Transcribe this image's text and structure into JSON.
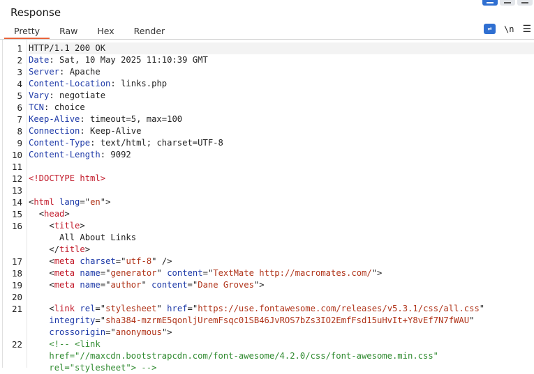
{
  "panel": {
    "title": "Response"
  },
  "tabs": [
    {
      "label": "Pretty"
    },
    {
      "label": "Raw"
    },
    {
      "label": "Hex"
    },
    {
      "label": "Render"
    }
  ],
  "toolbar": {
    "newline_label": "\\n"
  },
  "icons": {
    "layout_split": "layout-split-icon",
    "layout_horizontal": "layout-horizontal-icon",
    "layout_vertical": "layout-vertical-icon",
    "wrap": "wrap-lines-icon",
    "menu": "hamburger-menu-icon"
  },
  "colors": {
    "accent": "#2f6fd1",
    "tab_underline": "#e8643a"
  },
  "line_numbers": [
    "1",
    "2",
    "3",
    "4",
    "5",
    "6",
    "7",
    "8",
    "9",
    "10",
    "11",
    "12",
    "13",
    "14",
    "15",
    "16",
    "17",
    "18",
    "19",
    "20",
    "21",
    "22"
  ],
  "lines": {
    "l1": [
      "HTTP/1.1 200 OK"
    ],
    "l2": [
      "Date",
      ": Sat, 10 May 2025 11:10:39 GMT"
    ],
    "l3": [
      "Server",
      ": Apache"
    ],
    "l4": [
      "Content-Location",
      ": links.php"
    ],
    "l5": [
      "Vary",
      ": negotiate"
    ],
    "l6": [
      "TCN",
      ": choice"
    ],
    "l7": [
      "Keep-Alive",
      ": timeout=5, max=100"
    ],
    "l8": [
      "Connection",
      ": Keep-Alive"
    ],
    "l9": [
      "Content-Type",
      ": text/html; charset=UTF-8"
    ],
    "l10": [
      "Content-Length",
      ": 9092"
    ],
    "l12": [
      "<!DOCTYPE html>"
    ],
    "l14": [
      "<",
      "html",
      " ",
      "lang",
      "=\"",
      "en",
      "\">"
    ],
    "l15": [
      "<",
      "head",
      ">"
    ],
    "l16a": [
      "<",
      "title",
      ">"
    ],
    "l16b": [
      "All About Links"
    ],
    "l16c": [
      "</",
      "title",
      ">"
    ],
    "l17": [
      "<",
      "meta",
      " ",
      "charset",
      "=\"",
      "utf-8",
      "\" />"
    ],
    "l18": [
      "<",
      "meta",
      " ",
      "name",
      "=\"",
      "generator",
      "\" ",
      "content",
      "=\"",
      "TextMate http://macromates.com/",
      "\">"
    ],
    "l19": [
      "<",
      "meta",
      " ",
      "name",
      "=\"",
      "author",
      "\" ",
      "content",
      "=\"",
      "Dane Groves",
      "\">"
    ],
    "l21a": [
      "<",
      "link",
      " ",
      "rel",
      "=\"",
      "stylesheet",
      "\" ",
      "href",
      "=\"",
      "https://use.fontawesome.com/releases/v5.3.1/css/all.css",
      "\""
    ],
    "l21b": [
      "integrity",
      "=\"",
      "sha384-mzrmE5qonljUremFsqc01SB46JvROS7bZs3IO2EmfFsd15uHvIt+Y8vEf7N7fWAU",
      "\""
    ],
    "l21c": [
      "crossorigin",
      "=\"",
      "anonymous",
      "\">"
    ],
    "l22a": [
      "<!-- <link"
    ],
    "l22b": [
      "href=\"//maxcdn.bootstrapcdn.com/font-awesome/4.2.0/css/font-awesome.min.css\""
    ],
    "l22c": [
      "rel=\"stylesheet\"> -->"
    ]
  }
}
